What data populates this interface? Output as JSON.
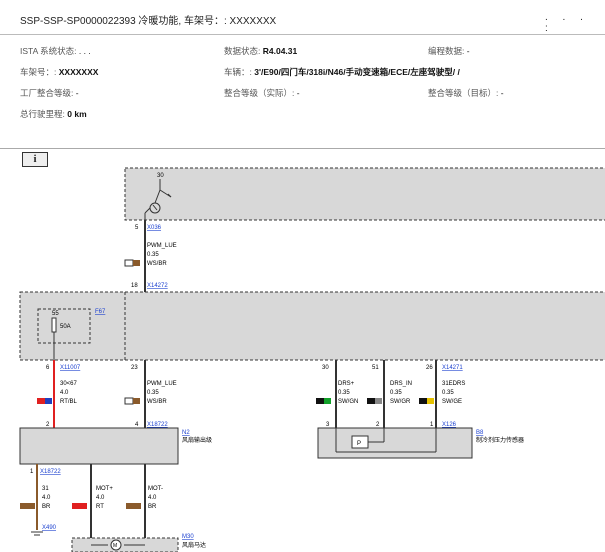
{
  "header": {
    "title": "SSP-SSP-SP0000022393 冷暖功能, 车架号：: XXXXXXX",
    "dots": ". . . :"
  },
  "info": {
    "ista_label": "ISTA 系统状态:",
    "ista_value": ". . .",
    "data_label": "数据状态:",
    "data_value": "R4.04.31",
    "prog_label": "编程数据:",
    "prog_value": "-",
    "vin_label": "车架号：:",
    "vin_value": "XXXXXXX",
    "vehicle_label": "车辆：:",
    "vehicle_value": "3'/E90/四门车/318i/N46/手动变速箱/ECE/左座驾驶型/      /",
    "factory_label": "工厂整合等级:",
    "factory_value": "-",
    "actual_label": "整合等级（实际）:",
    "actual_value": "-",
    "target_label": "整合等级（目标）:",
    "target_value": "-",
    "mileage_label": "总行驶里程:",
    "mileage_value": "0 km"
  },
  "info_icon": "i",
  "diagram": {
    "pin30": "30",
    "x036_pin": "5",
    "x036": "X036",
    "w1": [
      "PWM_LUE",
      "0.35",
      "WS/BR"
    ],
    "x14272_pin": "18",
    "x14272": "X14272",
    "fuse_num": "55",
    "fuse_amp": "50A",
    "f67": "F67",
    "x11007_pin": "6",
    "x11007": "X11007",
    "w2": [
      "30<67",
      "4.0",
      "RT/BL"
    ],
    "x23_pin": "23",
    "w3": [
      "PWM_LUE",
      "0.35",
      "WS/BR"
    ],
    "p30": "30",
    "p51": "51",
    "p26": "26",
    "x14271": "X14271",
    "w4": [
      "DRS+",
      "0.35",
      "SW/GN"
    ],
    "w5": [
      "DRS_IN",
      "0.35",
      "SW/GR"
    ],
    "w6": [
      "31EDRS",
      "0.35",
      "SW/GE"
    ],
    "n2_pin2": "2",
    "n2_pin4": "4",
    "x18722": "X18722",
    "n2": "N2",
    "n2_desc": "风扇输出级",
    "b8_pin3": "3",
    "b8_pin2": "2",
    "b8_pin1": "1",
    "x126": "X126",
    "b8": "B8",
    "b8_desc": "制冷剂压力传感器",
    "p_label": "P",
    "x18722b_pin": "1",
    "x18722b": "X18722",
    "w7": [
      "31",
      "4.0",
      "BR"
    ],
    "w8": [
      "MOT+",
      "4.0",
      "RT"
    ],
    "w9": [
      "MOT-",
      "4.0",
      "BR"
    ],
    "x490": "X490",
    "m30": "M30",
    "m30_desc": "风扇马达",
    "m_label": "M"
  },
  "colors": {
    "red": "#e02020",
    "blue": "#1f3fbf",
    "brown": "#8a5a2b",
    "green": "#12a12a",
    "gray": "#888888",
    "yellow": "#e6c200",
    "link": "#1a3fcf",
    "module": "#d8d8d8"
  }
}
